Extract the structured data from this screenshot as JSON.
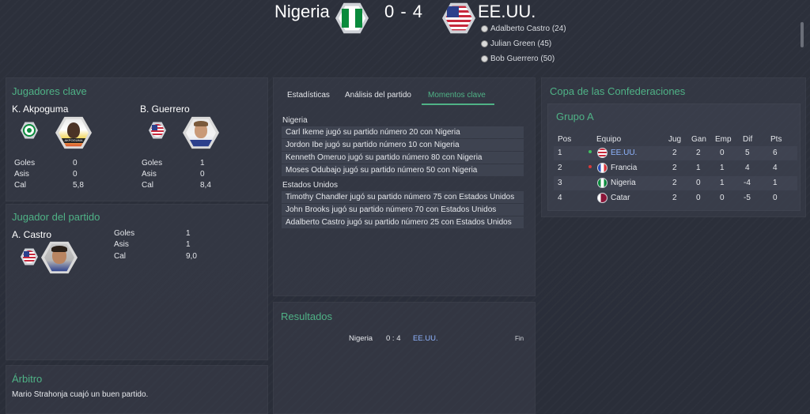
{
  "header": {
    "home_team": "Nigeria",
    "away_team": "EE.UU.",
    "score": "0 - 4",
    "scorers": [
      {
        "label": "Adalberto Castro (24)"
      },
      {
        "label": "Julian Green (45)"
      },
      {
        "label": "Bob Guerrero (50)"
      }
    ]
  },
  "key_players": {
    "title": "Jugadores clave",
    "players": [
      {
        "name": "K. Akpoguma",
        "photo_caption": "AKPOGUMA",
        "stats": [
          {
            "label": "Goles",
            "value": "0"
          },
          {
            "label": "Asis",
            "value": "0"
          },
          {
            "label": "Cal",
            "value": "5,8"
          }
        ]
      },
      {
        "name": "B. Guerrero",
        "stats": [
          {
            "label": "Goles",
            "value": "1"
          },
          {
            "label": "Asis",
            "value": "0"
          },
          {
            "label": "Cal",
            "value": "8,4"
          }
        ]
      }
    ]
  },
  "player_of_match": {
    "title": "Jugador del partido",
    "name": "A. Castro",
    "stats": [
      {
        "label": "Goles",
        "value": "1"
      },
      {
        "label": "Asis",
        "value": "1"
      },
      {
        "label": "Cal",
        "value": "9,0"
      }
    ]
  },
  "referee": {
    "title": "Árbitro",
    "text": "Mario Strahonja cuajó un buen partido."
  },
  "tabs": [
    {
      "label": "Estadísticas"
    },
    {
      "label": "Análisis del partido"
    },
    {
      "label": "Momentos clave"
    }
  ],
  "moments": {
    "groups": [
      {
        "team": "Nigeria",
        "items": [
          "Carl Ikeme jugó su partido número 20 con Nigeria",
          "Jordon Ibe jugó su partido número 10 con Nigeria",
          "Kenneth Omeruo jugó su partido número 80 con Nigeria",
          "Moses Odubajo jugó su partido número 50 con Nigeria"
        ]
      },
      {
        "team": "Estados Unidos",
        "items": [
          "Timothy Chandler jugó su partido número 75 con Estados Unidos",
          "John Brooks jugó su partido número 70 con Estados Unidos",
          "Adalberto Castro jugó su partido número 25 con Estados Unidos"
        ]
      }
    ]
  },
  "results": {
    "title": "Resultados",
    "home": "Nigeria",
    "score": "0 : 4",
    "away": "EE.UU.",
    "status": "Fin"
  },
  "competition": {
    "title": "Copa de las Confederaciones",
    "group": "Grupo A",
    "headers": [
      "Pos",
      "Equipo",
      "Jug",
      "Gan",
      "Emp",
      "Dif",
      "Pts"
    ],
    "rows": [
      {
        "pos": "1",
        "team": "EE.UU.",
        "jug": "2",
        "gan": "2",
        "emp": "0",
        "dif": "5",
        "pts": "6",
        "highlight": true
      },
      {
        "pos": "2",
        "team": "Francia",
        "jug": "2",
        "gan": "1",
        "emp": "1",
        "dif": "4",
        "pts": "4",
        "highlight": false
      },
      {
        "pos": "3",
        "team": "Nigeria",
        "jug": "2",
        "gan": "0",
        "emp": "1",
        "dif": "-4",
        "pts": "1",
        "highlight": false
      },
      {
        "pos": "4",
        "team": "Catar",
        "jug": "2",
        "gan": "0",
        "emp": "0",
        "dif": "-5",
        "pts": "0",
        "highlight": false
      }
    ]
  },
  "colors": {
    "accent": "#4fb286",
    "link": "#8fb4ff",
    "up_arrow": "#3fbf60",
    "down_arrow": "#d83a3a"
  }
}
